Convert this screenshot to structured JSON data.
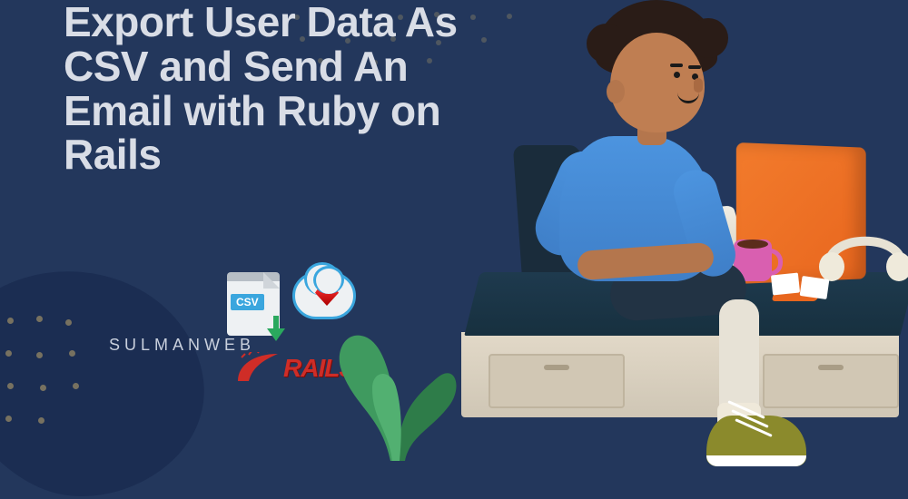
{
  "title": "Export User Data As CSV and Send An Email with Ruby on Rails",
  "brand": "SULMANWEB",
  "badges": {
    "csv_label": "CSV",
    "rails_label": "RAILS"
  }
}
